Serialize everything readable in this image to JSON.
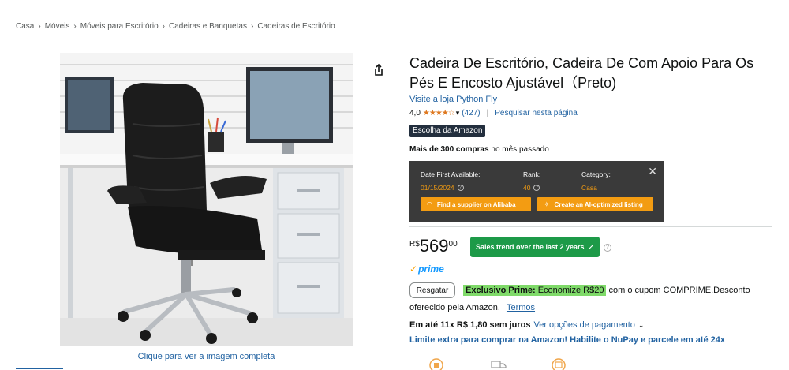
{
  "breadcrumb": [
    "Casa",
    "Móveis",
    "Móveis para Escritório",
    "Cadeiras e Banquetas",
    "Cadeiras de Escritório"
  ],
  "image": {
    "caption": "Clique para ver a imagem completa",
    "alt": "Cadeira de escritório preta com apoio para os pés"
  },
  "product": {
    "title": "Cadeira De Escritório, Cadeira De Com Apoio Para Os Pés E Encosto Ajustável（Preto)",
    "store_link": "Visite a loja Python Fly",
    "rating_value": "4,0",
    "stars": "★★★★☆",
    "rating_count": "(427)",
    "search_page": "Pesquisar nesta página",
    "choice_badge_prefix": "Escolha da",
    "choice_badge_brand": "Amazon",
    "purchases_bold": "Mais de 300 compras",
    "purchases_rest": " no mês passado"
  },
  "extension": {
    "date_label": "Date First Available:",
    "date_value": "01/15/2024",
    "rank_label": "Rank:",
    "rank_value": "40",
    "category_label": "Category:",
    "category_value": "Casa",
    "supplier_button": "Find a supplier on Alibaba",
    "listing_button": "Create an AI-optimized listing",
    "close": "✕"
  },
  "price": {
    "currency": "R$",
    "whole": "569",
    "fraction": "00",
    "trend_button": "Sales trend over the last 2 years",
    "prime_label": "prime"
  },
  "coupon": {
    "redeem_button": "Resgatar",
    "highlight_bold": "Exclusivo Prime:",
    "highlight_rest": " Economize R$20",
    "after_highlight": " com o cupom COMPRIME.Desconto",
    "continuation": "oferecido pela Amazon.",
    "terms": "Termos"
  },
  "installments": {
    "bold": "Em até 11x R$ 1,80 sem juros",
    "options_link": "Ver opções de pagamento",
    "nupay": "Limite extra para comprar na Amazon! Habilite o NuPay e parcele em até 24x"
  },
  "colors": {
    "link": "#2162a1",
    "star": "#de7921",
    "extension_bg": "#3a3a3a",
    "extension_accent": "#f39c12",
    "trend_green": "#1d9a48",
    "coupon_green": "#7fda69",
    "prime_blue": "#1399ff"
  }
}
